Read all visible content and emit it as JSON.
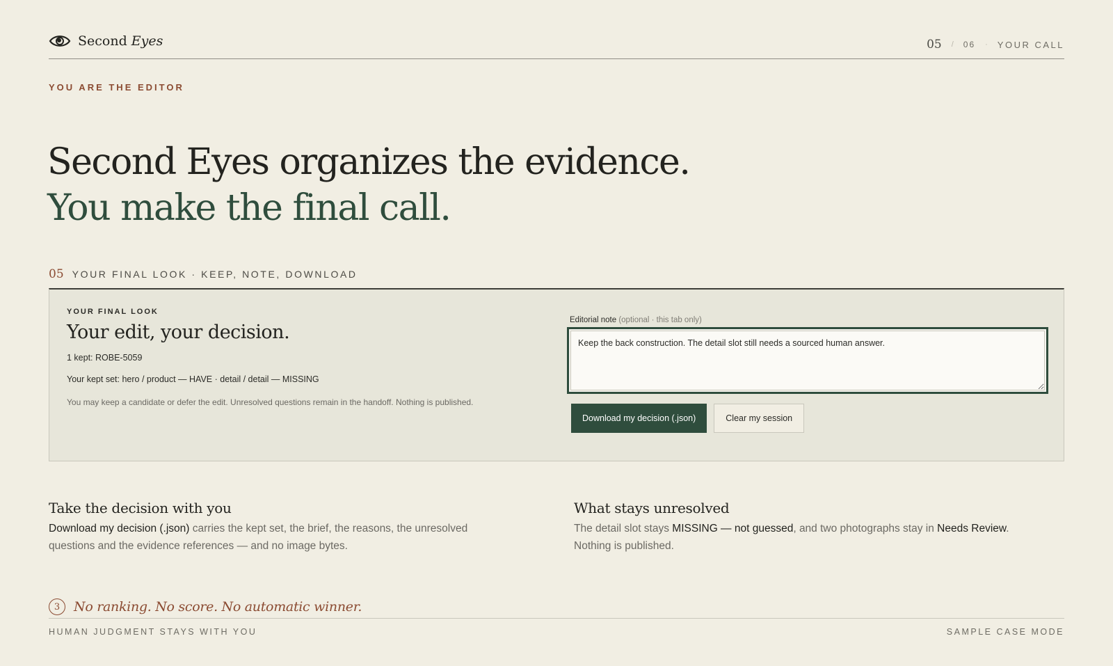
{
  "header": {
    "brand_first": "Second",
    "brand_second": "Eyes",
    "step_current": "05",
    "step_sep1": "/",
    "step_total": "06",
    "step_sep2": "·",
    "step_label": "YOUR CALL"
  },
  "eyebrow": "YOU ARE THE EDITOR",
  "headline": {
    "line1": "Second Eyes organizes the evidence.",
    "line2": "You make the final call."
  },
  "section": {
    "number": "05",
    "label": "YOUR FINAL LOOK · KEEP, NOTE, DOWNLOAD"
  },
  "panel": {
    "kicker": "YOUR FINAL LOOK",
    "title": "Your edit, your decision.",
    "kept_count": "1 kept: ROBE-5059",
    "kept_set": "Your kept set: hero / product — HAVE · detail / detail — MISSING",
    "disclaimer": "You may keep a candidate or defer the edit. Unresolved questions remain in the handoff. Nothing is published.",
    "note_label": "Editorial note",
    "note_hint": "(optional · this tab only)",
    "note_value": "Keep the back construction. The detail slot still needs a sourced human answer.",
    "download_label": "Download my decision (.json)",
    "clear_label": "Clear my session"
  },
  "take": {
    "title": "Take the decision with you",
    "strong": "Download my decision (.json)",
    "body": " carries the kept set, the brief, the reasons, the unresolved questions and the evidence references — and no image bytes."
  },
  "unresolved": {
    "title": "What stays unresolved",
    "pre": "The detail slot stays ",
    "strong1": "MISSING — not guessed",
    "mid": ", and two photographs stay in ",
    "strong2": "Needs Review",
    "post": ". Nothing is published."
  },
  "footer": {
    "circle_number": "3",
    "quote": "No ranking. No score. No automatic winner.",
    "left": "HUMAN JUDGMENT STAYS WITH YOU",
    "right": "SAMPLE CASE MODE"
  },
  "colors": {
    "background": "#f1eee3",
    "accent_green": "#2f4d3d",
    "accent_rust": "#8b4b32",
    "panel": "#e7e6da"
  },
  "icons": {
    "brand": "eye-icon"
  }
}
